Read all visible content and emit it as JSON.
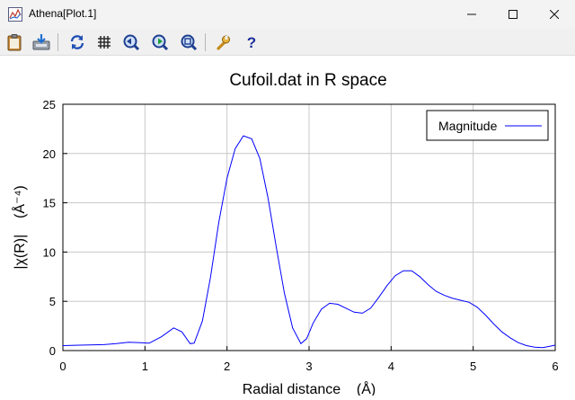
{
  "window": {
    "title": "Athena[Plot.1]",
    "minimize_icon": "minimize-icon",
    "maximize_icon": "maximize-icon",
    "close_icon": "close-icon"
  },
  "toolbar": {
    "items": [
      {
        "name": "clipboard-icon",
        "tooltip": ""
      },
      {
        "name": "save-icon",
        "tooltip": ""
      },
      {
        "name": "refresh-icon",
        "tooltip": ""
      },
      {
        "name": "grid-icon",
        "tooltip": ""
      },
      {
        "name": "zoom-back-icon",
        "tooltip": ""
      },
      {
        "name": "zoom-forward-icon",
        "tooltip": ""
      },
      {
        "name": "zoom-reset-icon",
        "tooltip": ""
      },
      {
        "name": "wrench-icon",
        "tooltip": ""
      },
      {
        "name": "help-icon",
        "tooltip": ""
      }
    ]
  },
  "colors": {
    "series": "#0000ff",
    "grid": "#c8c8c8",
    "axes": "#000000"
  },
  "chart_data": {
    "type": "line",
    "title": "Cufoil.dat in R space",
    "xlabel": "Radial distance    (Å)",
    "ylabel": "|χ(R)|    (Å⁻⁴)",
    "xlim": [
      0,
      6
    ],
    "ylim": [
      0,
      25
    ],
    "xticks": [
      0,
      1,
      2,
      3,
      4,
      5,
      6
    ],
    "yticks": [
      0,
      5,
      10,
      15,
      20,
      25
    ],
    "grid": true,
    "legend": "top-right",
    "series": [
      {
        "name": "Magnitude",
        "color": "#0000ff",
        "x": [
          0.0,
          0.2,
          0.5,
          0.65,
          0.8,
          0.95,
          1.05,
          1.2,
          1.35,
          1.45,
          1.55,
          1.6,
          1.7,
          1.8,
          1.9,
          2.0,
          2.1,
          2.2,
          2.3,
          2.4,
          2.5,
          2.6,
          2.7,
          2.8,
          2.9,
          2.97,
          3.05,
          3.15,
          3.25,
          3.35,
          3.45,
          3.55,
          3.65,
          3.75,
          3.85,
          3.95,
          4.05,
          4.15,
          4.25,
          4.35,
          4.45,
          4.55,
          4.65,
          4.75,
          4.85,
          4.95,
          5.05,
          5.15,
          5.25,
          5.35,
          5.45,
          5.55,
          5.65,
          5.75,
          5.85,
          6.0
        ],
        "y": [
          0.5,
          0.55,
          0.6,
          0.7,
          0.85,
          0.8,
          0.75,
          1.4,
          2.3,
          1.9,
          0.7,
          0.75,
          3.0,
          7.5,
          13.0,
          17.5,
          20.5,
          21.8,
          21.5,
          19.5,
          15.5,
          10.5,
          5.8,
          2.3,
          0.7,
          1.2,
          2.8,
          4.2,
          4.8,
          4.7,
          4.3,
          3.9,
          3.8,
          4.3,
          5.4,
          6.6,
          7.6,
          8.1,
          8.1,
          7.5,
          6.7,
          6.0,
          5.6,
          5.3,
          5.1,
          4.9,
          4.4,
          3.6,
          2.7,
          1.9,
          1.3,
          0.8,
          0.5,
          0.35,
          0.3,
          0.55
        ]
      }
    ]
  }
}
